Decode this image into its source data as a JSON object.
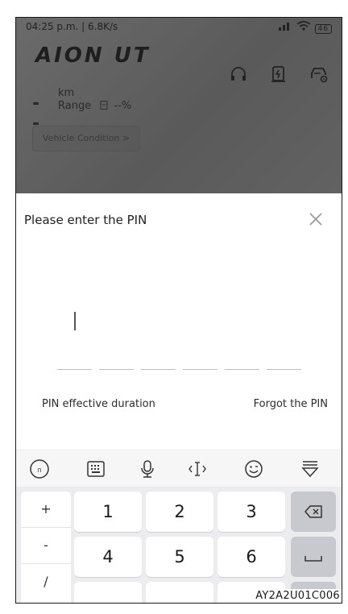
{
  "status_bar": {
    "time_speed": "04:25 p.m. | 6.8K/s",
    "battery_level": "46"
  },
  "header": {
    "logo_text": "AION UT",
    "icons": [
      "headset-icon",
      "charging-icon",
      "car-settings-icon"
    ]
  },
  "vehicle": {
    "range_value": "--",
    "range_unit": "km",
    "range_label": "Range",
    "battery_percent": "--%",
    "condition_button": "Vehicle Condition >"
  },
  "pin_dialog": {
    "title": "Please enter the PIN",
    "close_icon": "close-icon",
    "slots": 6,
    "entered_digits": 0,
    "effective_duration_link": "PIN effective duration",
    "forgot_link": "Forgot the PIN"
  },
  "keyboard": {
    "toolbar_icons": [
      "language-icon",
      "keyboard-icon",
      "microphone-icon",
      "cursor-icon",
      "emoji-icon",
      "hide-keyboard-icon"
    ],
    "side_keys": [
      "+",
      "-",
      "/"
    ],
    "digit_keys": [
      "1",
      "2",
      "3",
      "4",
      "5",
      "6"
    ],
    "function_keys": [
      "backspace-icon",
      "space-icon"
    ]
  },
  "watermark": "AY2A2U01C006",
  "colors": {
    "dim_overlay": "#5f5f5f",
    "sheet_bg": "#ffffff",
    "keyboard_bg": "#ececee",
    "function_key_bg": "#c7c9ce"
  }
}
